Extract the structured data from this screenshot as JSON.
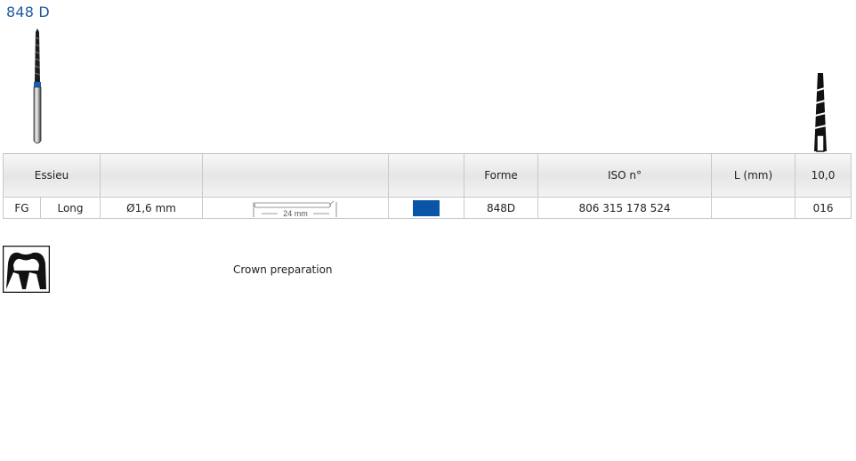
{
  "title": "848 D",
  "table": {
    "header": {
      "essieu": "Essieu",
      "forme": "Forme",
      "iso": "ISO n°",
      "length": "L (mm)",
      "length_value": "10,0"
    },
    "row": {
      "shank": "FG",
      "shank_type": "Long",
      "diameter": "Ø1,6 mm",
      "shank_length": "24 mm",
      "color": "#0a55a8",
      "forme": "848D",
      "iso": "806 315 178 524",
      "size": "016"
    }
  },
  "indication": "Crown preparation",
  "icons": {
    "product": "dental-bur-image",
    "profile": "taper-profile-icon",
    "indication": "crown-tooth-icon"
  }
}
